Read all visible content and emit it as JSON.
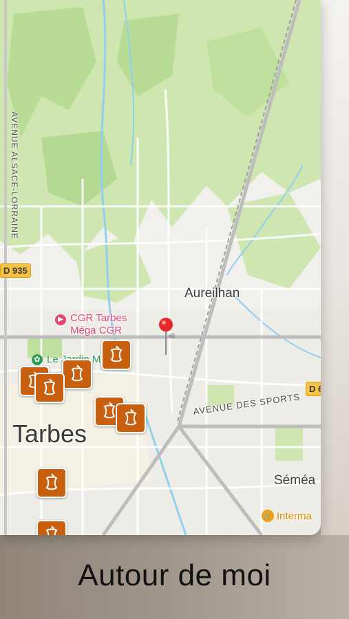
{
  "map": {
    "places": {
      "city": "Tarbes",
      "town1": "Aureilhan",
      "town2": "Séméa",
      "cinema_line1": "CGR Tarbes",
      "cinema_line2": "Méga CGR",
      "garden": "Le Jardin Massey",
      "store": "Interma"
    },
    "roads": {
      "avenue_left": "AVENUE ALSACE-LORRAINE",
      "avenue_sports": "AVENUE DES SPORTS",
      "shield_left": "D 935",
      "shield_right": "D 6"
    },
    "pin_icon": "red-location-pin",
    "poi_icon": "apple-core-compost-icon",
    "colors": {
      "poi": "#c9600f",
      "pin": "#e8272d",
      "cinema": "#e2497a",
      "garden": "#2e9e55",
      "store": "#f2a10f"
    }
  },
  "footer": {
    "title": "Autour de moi"
  }
}
